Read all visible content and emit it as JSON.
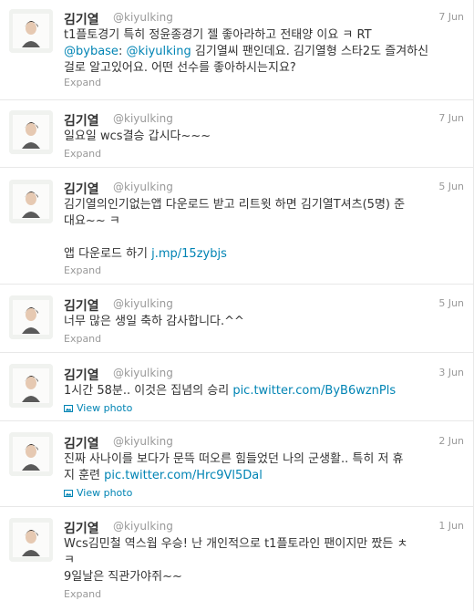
{
  "user": {
    "fullname": "김기열",
    "username": "@kiyulking"
  },
  "ui": {
    "expand_label": "Expand",
    "view_photo_label": "View photo"
  },
  "tweets": [
    {
      "time": "7 Jun",
      "text": {
        "l1": "t1플토경기 특히 정윤종경기 젤 좋아라하고 전태양 이요 ㅋ  RT",
        "l2_link": "@bybase",
        "l2_sep": ": ",
        "l2_mention": "@kiyulking",
        "l2_rest": " 김기열씨 팬인데요. 김기열형 스타2도 즐겨하신",
        "l3": "걸로 알고있어요. 어떤 선수를 좋아하시는지요?"
      }
    },
    {
      "time": "7 Jun",
      "text": {
        "l1": "일요일 wcs결승 갑시다~~~"
      }
    },
    {
      "time": "5 Jun",
      "text": {
        "l1": "김기열의인기없는앱 다운로드 받고 리트윗 하면 김기열T셔츠(5명) 준",
        "l2": "대요~~ ㅋ",
        "l4_prefix": "앱 다운로드 하기 ",
        "l4_link": "j.mp/15zybjs"
      }
    },
    {
      "time": "5 Jun",
      "text": {
        "l1": "너무 많은 생일 축하 감사합니다.^^"
      }
    },
    {
      "time": "3 Jun",
      "text": {
        "l1_prefix": "1시간 58분..  이것은 집념의 승리 ",
        "l1_link": "pic.twitter.com/ByB6wznPls"
      }
    },
    {
      "time": "2 Jun",
      "text": {
        "l1": "진짜 사나이를 보다가 문뜩 떠오른 힘들었던 나의 군생활..  특히 저 휴",
        "l2_prefix": "지 훈련 ",
        "l2_link": "pic.twitter.com/Hrc9Vl5Dal"
      }
    },
    {
      "time": "1 Jun",
      "text": {
        "l1": "Wcs김민철 역스웝 우승! 난 개인적으로 t1플토라인 팬이지만 짰든 ㅊ",
        "l2": "ㅋ",
        "l3": "9일날은 직관가야쥐~~"
      }
    }
  ],
  "colors": {
    "link": "#0084b4",
    "text": "#333333",
    "meta": "#999999",
    "divider": "#e8e8e8"
  },
  "icons": {
    "photo": "photo-icon"
  }
}
